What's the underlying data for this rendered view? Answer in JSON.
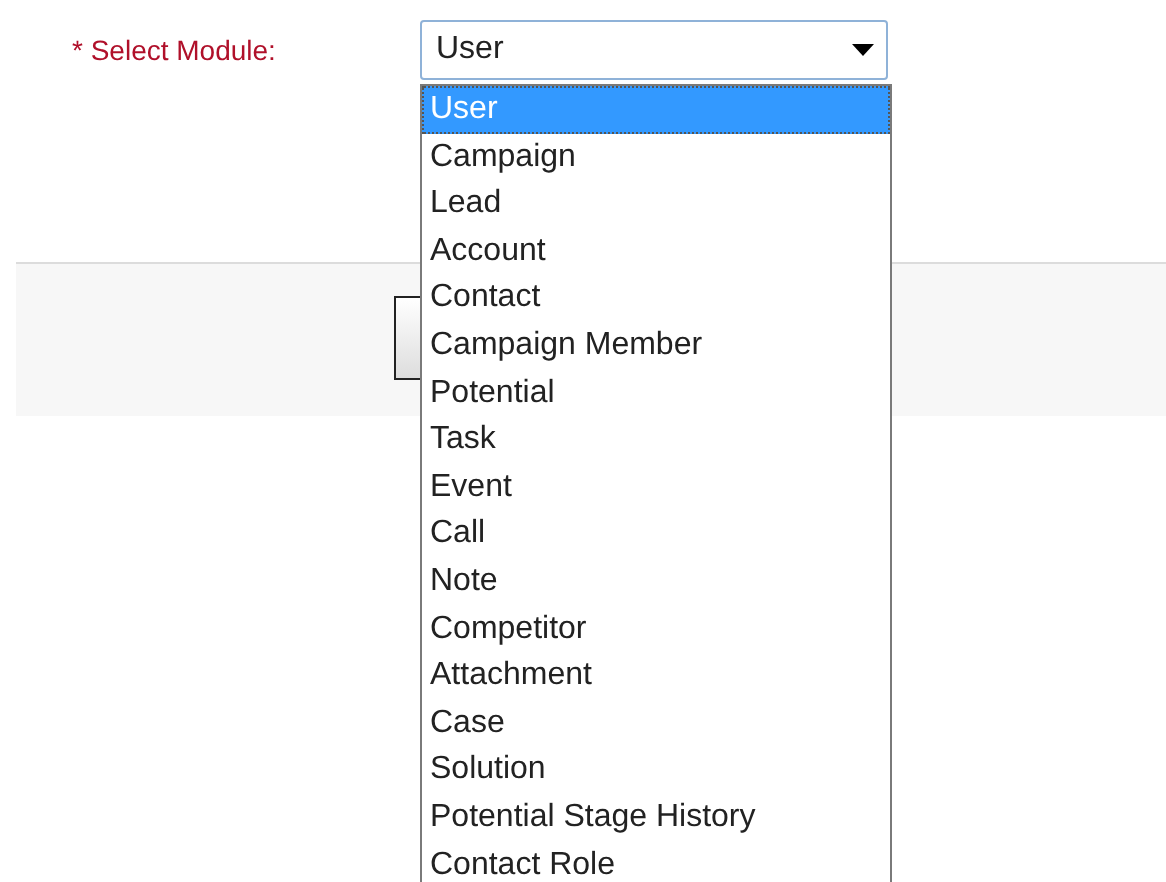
{
  "form": {
    "label": "* Select Module:",
    "select": {
      "value": "User"
    }
  },
  "dropdown": {
    "options": [
      {
        "label": "User",
        "selected": true
      },
      {
        "label": "Campaign",
        "selected": false
      },
      {
        "label": "Lead",
        "selected": false
      },
      {
        "label": "Account",
        "selected": false
      },
      {
        "label": "Contact",
        "selected": false
      },
      {
        "label": "Campaign Member",
        "selected": false
      },
      {
        "label": "Potential",
        "selected": false
      },
      {
        "label": "Task",
        "selected": false
      },
      {
        "label": "Event",
        "selected": false
      },
      {
        "label": "Call",
        "selected": false
      },
      {
        "label": "Note",
        "selected": false
      },
      {
        "label": "Competitor",
        "selected": false
      },
      {
        "label": "Attachment",
        "selected": false
      },
      {
        "label": "Case",
        "selected": false
      },
      {
        "label": "Solution",
        "selected": false
      },
      {
        "label": "Potential Stage History",
        "selected": false
      },
      {
        "label": "Contact Role",
        "selected": false
      }
    ]
  }
}
